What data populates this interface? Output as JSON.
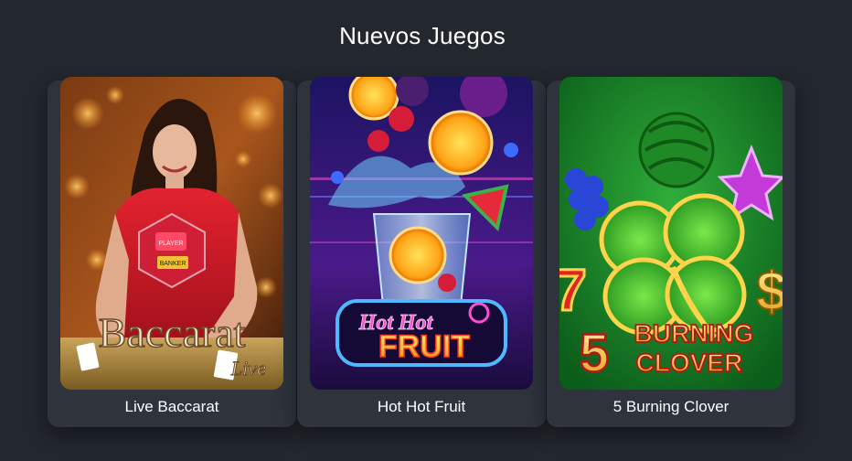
{
  "section": {
    "title": "Nuevos Juegos"
  },
  "games": [
    {
      "label": "Live Baccarat",
      "art_title": "Baccarat",
      "art_subtitle": "Live",
      "art_player": "PLAYER",
      "art_banker": "BANKER"
    },
    {
      "label": "Hot Hot Fruit",
      "art_title_top": "Hot Hot",
      "art_title_bottom": "FRUIT"
    },
    {
      "label": "5 Burning Clover",
      "art_number": "5",
      "art_title_top": "BURNING",
      "art_title_bottom": "CLOVER"
    }
  ],
  "colors": {
    "background": "#23272e",
    "card": "#2e333c",
    "text": "#ffffff"
  }
}
